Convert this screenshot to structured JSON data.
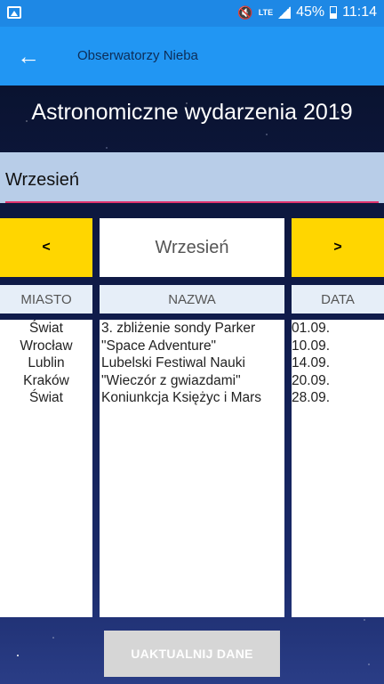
{
  "statusbar": {
    "lte": "LTE",
    "battery": "45%",
    "time": "11:14",
    "icons": [
      "image-icon",
      "mute-icon",
      "signal-icon",
      "battery-icon"
    ]
  },
  "appbar": {
    "back_icon": "arrow-left-icon",
    "title": "Obserwatorzy Nieba",
    "color": "#2196f3"
  },
  "header": {
    "title": "Astronomiczne wydarzenia 2019"
  },
  "month_field": {
    "value": "Wrzesień",
    "accent": "#e0336e"
  },
  "nav": {
    "prev_label": "<",
    "next_label": ">",
    "current_month": "Wrzesień",
    "button_color": "#ffd600"
  },
  "table": {
    "columns": [
      "MIASTO",
      "NAZWA",
      "DATA"
    ],
    "rows": [
      {
        "city": "Świat",
        "name": "3. zbliżenie sondy Parker",
        "date": "01.09."
      },
      {
        "city": "Wrocław",
        "name": "\"Space Adventure\"",
        "date": "10.09."
      },
      {
        "city": "Lublin",
        "name": "Lubelski Festiwal Nauki",
        "date": "14.09."
      },
      {
        "city": "Kraków",
        "name": "\"Wieczór z gwiazdami\"",
        "date": "20.09."
      },
      {
        "city": "Świat",
        "name": "Koniunkcja Księżyc i Mars",
        "date": "28.09."
      }
    ]
  },
  "update_button": {
    "label": "UAKTUALNIJ DANE"
  }
}
